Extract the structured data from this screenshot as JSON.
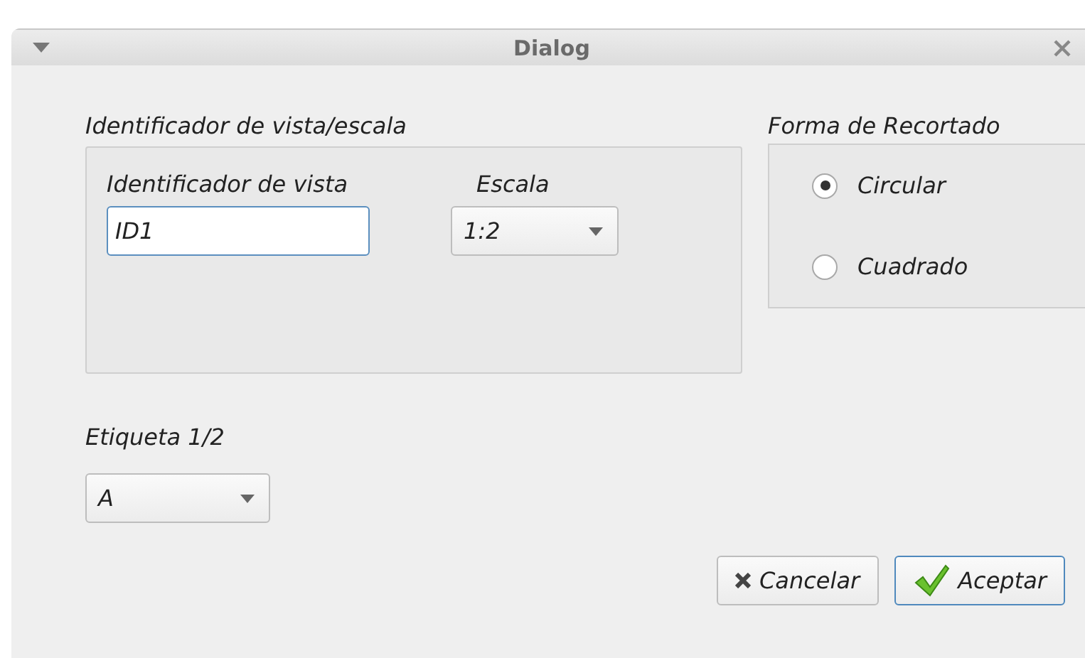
{
  "window": {
    "title": "Dialog"
  },
  "view_group": {
    "title": "Identificador de vista/escala",
    "id_label": "Identificador de vista",
    "id_value": "ID1",
    "scale_label": "Escala",
    "scale_value": "1:2"
  },
  "clip_group": {
    "title": "Forma de Recortado",
    "options": [
      {
        "label": "Circular",
        "selected": true
      },
      {
        "label": "Cuadrado",
        "selected": false
      }
    ]
  },
  "label_field": {
    "label": "Etiqueta 1/2",
    "value": "A"
  },
  "buttons": [
    {
      "label": "Cancelar",
      "kind": "cancel",
      "default": false
    },
    {
      "label": "Aceptar",
      "kind": "ok",
      "default": true
    }
  ]
}
